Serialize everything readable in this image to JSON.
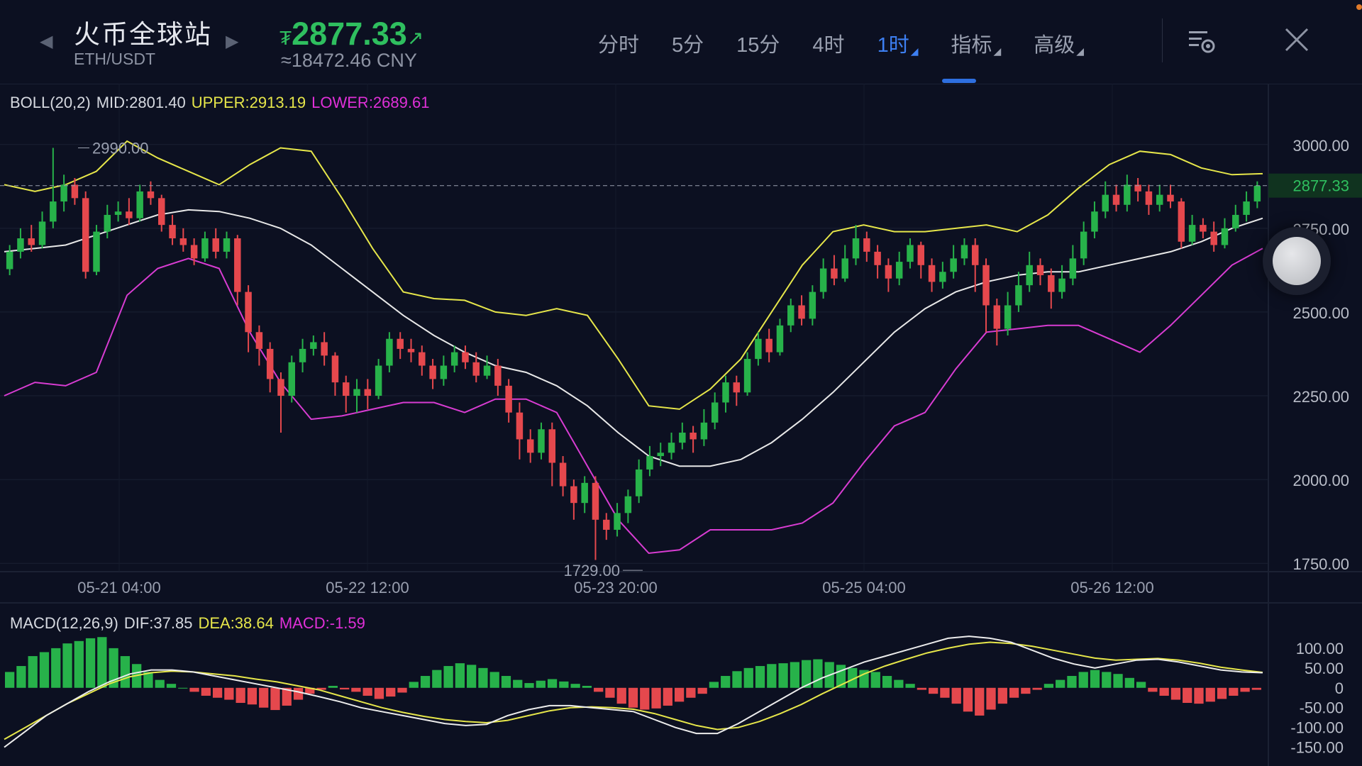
{
  "header": {
    "market_name": "火币全球站",
    "pair": "ETH/USDT",
    "price_symbol": "₮",
    "price": "2877.33",
    "price_direction": "↗",
    "cny": "≈18472.46 CNY",
    "prev_icon": "chevron-left-icon",
    "next_icon": "chevron-right-icon"
  },
  "intervals": [
    {
      "label": "分时"
    },
    {
      "label": "5分"
    },
    {
      "label": "15分"
    },
    {
      "label": "4时"
    },
    {
      "label": "1时",
      "active": true,
      "dropdown": true
    },
    {
      "label": "指标",
      "dropdown": true
    },
    {
      "label": "高级",
      "dropdown": true
    }
  ],
  "toolbar": {
    "settings_icon": "chart-settings-icon",
    "close_icon": "close-icon"
  },
  "boll": {
    "name": "BOLL(20,2)",
    "mid": "MID:2801.40",
    "upper": "UPPER:2913.19",
    "lower": "LOWER:2689.61"
  },
  "macd": {
    "name": "MACD(12,26,9)",
    "dif": "DIF:37.85",
    "dea": "DEA:38.64",
    "macd": "MACD:-1.59"
  },
  "colors": {
    "background": "#0c1021",
    "up": "#27b24a",
    "down": "#e5484d",
    "boll_mid": "#e8e8e8",
    "boll_upper": "#e6e64a",
    "boll_lower": "#d83cd2",
    "accent": "#3d7ff2"
  },
  "chart_data": {
    "type": "candlestick",
    "price_axis": {
      "ticks": [
        "3000.00",
        "2750.00",
        "2500.00",
        "2250.00",
        "2000.00",
        "1750.00"
      ],
      "range": [
        1725,
        3135
      ]
    },
    "current_price": {
      "label": "2877.33",
      "value": 2877.33
    },
    "high_marker": {
      "label": "2990.00",
      "value": 2990
    },
    "low_marker": {
      "label": "1729.00",
      "value": 1729
    },
    "time_axis": [
      "05-21 04:00",
      "05-22 12:00",
      "05-23 20:00",
      "05-25 04:00",
      "05-26 12:00"
    ],
    "mid_band": [
      2680,
      2690,
      2700,
      2730,
      2760,
      2790,
      2805,
      2800,
      2780,
      2750,
      2700,
      2630,
      2560,
      2490,
      2430,
      2380,
      2340,
      2320,
      2280,
      2220,
      2140,
      2070,
      2040,
      2040,
      2060,
      2110,
      2180,
      2260,
      2350,
      2440,
      2510,
      2560,
      2590,
      2610,
      2620,
      2620,
      2640,
      2660,
      2680,
      2710,
      2750,
      2780
    ],
    "upper_band": [
      2880,
      2860,
      2880,
      2920,
      3010,
      2960,
      2920,
      2880,
      2940,
      2990,
      2980,
      2840,
      2690,
      2560,
      2540,
      2535,
      2500,
      2490,
      2510,
      2490,
      2360,
      2220,
      2210,
      2270,
      2360,
      2500,
      2640,
      2740,
      2760,
      2740,
      2740,
      2750,
      2760,
      2740,
      2790,
      2870,
      2940,
      2980,
      2970,
      2930,
      2910,
      2913
    ],
    "lower_band": [
      2250,
      2290,
      2280,
      2320,
      2550,
      2630,
      2660,
      2630,
      2440,
      2290,
      2180,
      2190,
      2210,
      2230,
      2230,
      2200,
      2240,
      2240,
      2200,
      2040,
      1880,
      1780,
      1790,
      1850,
      1850,
      1850,
      1870,
      1930,
      2050,
      2160,
      2200,
      2330,
      2440,
      2450,
      2460,
      2460,
      2420,
      2380,
      2460,
      2550,
      2640,
      2690
    ],
    "candles": [
      [
        2628,
        2680,
        2700,
        2610
      ],
      [
        2680,
        2720,
        2750,
        2660
      ],
      [
        2720,
        2700,
        2760,
        2680
      ],
      [
        2700,
        2770,
        2800,
        2690
      ],
      [
        2770,
        2830,
        2990,
        2750
      ],
      [
        2830,
        2880,
        2910,
        2800
      ],
      [
        2880,
        2840,
        2900,
        2820
      ],
      [
        2840,
        2620,
        2860,
        2600
      ],
      [
        2620,
        2740,
        2760,
        2610
      ],
      [
        2740,
        2790,
        2820,
        2720
      ],
      [
        2790,
        2800,
        2830,
        2770
      ],
      [
        2800,
        2780,
        2840,
        2760
      ],
      [
        2780,
        2860,
        2880,
        2770
      ],
      [
        2860,
        2840,
        2890,
        2820
      ],
      [
        2840,
        2760,
        2850,
        2740
      ],
      [
        2760,
        2720,
        2790,
        2700
      ],
      [
        2720,
        2700,
        2750,
        2680
      ],
      [
        2700,
        2660,
        2720,
        2640
      ],
      [
        2660,
        2720,
        2740,
        2650
      ],
      [
        2720,
        2680,
        2750,
        2660
      ],
      [
        2680,
        2720,
        2740,
        2660
      ],
      [
        2720,
        2560,
        2730,
        2520
      ],
      [
        2560,
        2440,
        2580,
        2380
      ],
      [
        2440,
        2390,
        2460,
        2340
      ],
      [
        2390,
        2300,
        2410,
        2260
      ],
      [
        2300,
        2250,
        2320,
        2140
      ],
      [
        2250,
        2350,
        2370,
        2230
      ],
      [
        2350,
        2390,
        2420,
        2320
      ],
      [
        2390,
        2410,
        2430,
        2370
      ],
      [
        2410,
        2370,
        2440,
        2340
      ],
      [
        2370,
        2290,
        2380,
        2250
      ],
      [
        2290,
        2250,
        2310,
        2200
      ],
      [
        2250,
        2270,
        2300,
        2200
      ],
      [
        2270,
        2250,
        2300,
        2210
      ],
      [
        2250,
        2340,
        2360,
        2240
      ],
      [
        2340,
        2420,
        2440,
        2320
      ],
      [
        2420,
        2390,
        2440,
        2360
      ],
      [
        2390,
        2380,
        2420,
        2350
      ],
      [
        2380,
        2340,
        2400,
        2310
      ],
      [
        2340,
        2300,
        2360,
        2270
      ],
      [
        2300,
        2340,
        2370,
        2280
      ],
      [
        2340,
        2380,
        2400,
        2320
      ],
      [
        2380,
        2350,
        2400,
        2330
      ],
      [
        2350,
        2310,
        2380,
        2290
      ],
      [
        2310,
        2340,
        2370,
        2300
      ],
      [
        2340,
        2280,
        2360,
        2250
      ],
      [
        2280,
        2200,
        2300,
        2170
      ],
      [
        2200,
        2120,
        2230,
        2060
      ],
      [
        2120,
        2080,
        2150,
        2050
      ],
      [
        2080,
        2150,
        2170,
        2060
      ],
      [
        2150,
        2050,
        2170,
        1980
      ],
      [
        2050,
        1980,
        2070,
        1950
      ],
      [
        1980,
        1930,
        2000,
        1880
      ],
      [
        1930,
        1990,
        2010,
        1900
      ],
      [
        1990,
        1880,
        2010,
        1760
      ],
      [
        1880,
        1850,
        1900,
        1820
      ],
      [
        1850,
        1900,
        1930,
        1830
      ],
      [
        1900,
        1950,
        1970,
        1870
      ],
      [
        1950,
        2030,
        2060,
        1930
      ],
      [
        2030,
        2070,
        2100,
        2010
      ],
      [
        2070,
        2080,
        2110,
        2040
      ],
      [
        2080,
        2110,
        2140,
        2060
      ],
      [
        2110,
        2140,
        2170,
        2090
      ],
      [
        2140,
        2120,
        2160,
        2080
      ],
      [
        2120,
        2170,
        2210,
        2100
      ],
      [
        2170,
        2230,
        2260,
        2150
      ],
      [
        2230,
        2290,
        2310,
        2200
      ],
      [
        2290,
        2260,
        2310,
        2220
      ],
      [
        2260,
        2360,
        2380,
        2250
      ],
      [
        2360,
        2420,
        2440,
        2340
      ],
      [
        2420,
        2380,
        2450,
        2350
      ],
      [
        2380,
        2460,
        2480,
        2370
      ],
      [
        2460,
        2520,
        2540,
        2440
      ],
      [
        2520,
        2480,
        2550,
        2460
      ],
      [
        2480,
        2560,
        2580,
        2460
      ],
      [
        2560,
        2630,
        2660,
        2540
      ],
      [
        2630,
        2600,
        2670,
        2580
      ],
      [
        2600,
        2660,
        2700,
        2590
      ],
      [
        2660,
        2720,
        2760,
        2640
      ],
      [
        2720,
        2680,
        2740,
        2650
      ],
      [
        2680,
        2640,
        2700,
        2600
      ],
      [
        2640,
        2600,
        2660,
        2560
      ],
      [
        2600,
        2650,
        2680,
        2580
      ],
      [
        2650,
        2700,
        2720,
        2630
      ],
      [
        2700,
        2640,
        2710,
        2600
      ],
      [
        2640,
        2590,
        2660,
        2560
      ],
      [
        2590,
        2620,
        2650,
        2570
      ],
      [
        2620,
        2660,
        2700,
        2600
      ],
      [
        2660,
        2700,
        2720,
        2640
      ],
      [
        2700,
        2640,
        2720,
        2560
      ],
      [
        2640,
        2520,
        2660,
        2440
      ],
      [
        2520,
        2450,
        2540,
        2400
      ],
      [
        2450,
        2520,
        2560,
        2430
      ],
      [
        2520,
        2580,
        2620,
        2500
      ],
      [
        2580,
        2640,
        2680,
        2560
      ],
      [
        2640,
        2610,
        2660,
        2580
      ],
      [
        2610,
        2560,
        2630,
        2510
      ],
      [
        2560,
        2600,
        2640,
        2540
      ],
      [
        2600,
        2660,
        2700,
        2580
      ],
      [
        2660,
        2740,
        2770,
        2640
      ],
      [
        2740,
        2800,
        2830,
        2720
      ],
      [
        2800,
        2850,
        2890,
        2780
      ],
      [
        2850,
        2820,
        2880,
        2800
      ],
      [
        2820,
        2880,
        2910,
        2800
      ],
      [
        2880,
        2860,
        2900,
        2830
      ],
      [
        2860,
        2820,
        2880,
        2790
      ],
      [
        2820,
        2850,
        2880,
        2800
      ],
      [
        2850,
        2830,
        2880,
        2810
      ],
      [
        2830,
        2710,
        2840,
        2690
      ],
      [
        2710,
        2760,
        2790,
        2700
      ],
      [
        2760,
        2740,
        2780,
        2720
      ],
      [
        2740,
        2700,
        2770,
        2680
      ],
      [
        2700,
        2750,
        2780,
        2690
      ],
      [
        2750,
        2790,
        2820,
        2740
      ],
      [
        2790,
        2830,
        2860,
        2770
      ],
      [
        2830,
        2877,
        2890,
        2810
      ]
    ]
  },
  "macd_chart": {
    "axis_ticks": [
      "100.00",
      "50.00",
      "0",
      "-50.00",
      "-100.00",
      "-150.00"
    ],
    "range": [
      -165,
      132
    ],
    "histogram": [
      40,
      55,
      80,
      90,
      100,
      112,
      118,
      125,
      128,
      100,
      80,
      60,
      40,
      20,
      10,
      0,
      -10,
      -20,
      -25,
      -30,
      -38,
      -42,
      -50,
      -56,
      -45,
      -30,
      -15,
      -5,
      5,
      -4,
      -10,
      -20,
      -28,
      -22,
      -12,
      15,
      30,
      45,
      55,
      62,
      58,
      50,
      40,
      30,
      20,
      12,
      18,
      22,
      16,
      10,
      5,
      -10,
      -25,
      -40,
      -50,
      -55,
      -52,
      -45,
      -35,
      -25,
      -15,
      15,
      30,
      42,
      50,
      55,
      60,
      62,
      65,
      70,
      72,
      65,
      58,
      50,
      45,
      40,
      30,
      20,
      10,
      -5,
      -15,
      -25,
      -40,
      -60,
      -70,
      -55,
      -40,
      -25,
      -15,
      -5,
      10,
      20,
      30,
      40,
      45,
      40,
      35,
      25,
      15,
      -10,
      -20,
      -30,
      -38,
      -40,
      -35,
      -28,
      -20,
      -10,
      -5
    ],
    "dif": [
      -150,
      -110,
      -70,
      -40,
      -10,
      15,
      35,
      45,
      45,
      40,
      30,
      20,
      10,
      0,
      -10,
      -22,
      -35,
      -50,
      -60,
      -70,
      -80,
      -90,
      -95,
      -92,
      -70,
      -55,
      -45,
      -45,
      -50,
      -55,
      -60,
      -80,
      -100,
      -115,
      -115,
      -90,
      -60,
      -30,
      0,
      25,
      45,
      65,
      80,
      95,
      110,
      125,
      130,
      125,
      115,
      95,
      75,
      60,
      50,
      60,
      70,
      72,
      65,
      55,
      45,
      40,
      38
    ],
    "dea": [
      -130,
      -100,
      -70,
      -40,
      -15,
      10,
      28,
      38,
      42,
      40,
      35,
      30,
      22,
      15,
      5,
      -5,
      -20,
      -35,
      -50,
      -62,
      -72,
      -80,
      -85,
      -88,
      -82,
      -70,
      -58,
      -50,
      -48,
      -50,
      -54,
      -65,
      -80,
      -95,
      -105,
      -100,
      -85,
      -65,
      -42,
      -15,
      10,
      35,
      55,
      72,
      88,
      100,
      110,
      115,
      112,
      105,
      95,
      85,
      75,
      70,
      72,
      74,
      70,
      62,
      52,
      45,
      39
    ]
  }
}
